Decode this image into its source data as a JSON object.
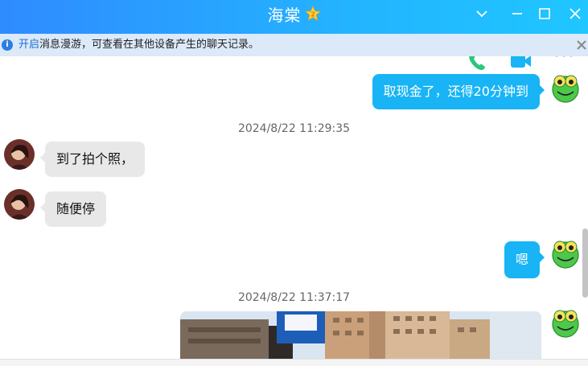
{
  "window": {
    "title": "海棠"
  },
  "notice": {
    "link": "开启",
    "text": "消息漫游，可查看在其他设备产生的聊天记录。"
  },
  "messages": [
    {
      "dir": "out",
      "text": "取现金了，还得20分钟到"
    },
    {
      "timestamp": "2024/8/22 11:29:35"
    },
    {
      "dir": "in",
      "text": "到了拍个照，"
    },
    {
      "dir": "in",
      "text": "随便停"
    },
    {
      "dir": "out",
      "text": "嗯"
    },
    {
      "timestamp": "2024/8/22 11:37:17"
    }
  ],
  "colors": {
    "accent": "#18b4f5",
    "title_gradient_start": "#2f8bff",
    "title_gradient_end": "#1fc6ff",
    "notice_bg": "#dbe9f8",
    "incoming_bubble": "#e8e8e8"
  },
  "icons": {
    "vip": "vip-badge-icon",
    "minimize": "chevron-down-icon",
    "restore": "minus-icon",
    "maximize": "square-icon",
    "close": "close-icon",
    "voice_call": "phone-icon",
    "video_call": "video-call-icon",
    "more": "more-icon"
  }
}
